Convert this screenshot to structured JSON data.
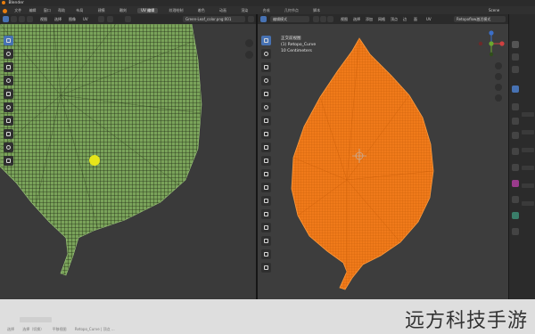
{
  "window": {
    "title": "Blender"
  },
  "menu": {
    "items": [
      "文件",
      "编辑",
      "窗口",
      "帮助"
    ],
    "workspaces": [
      "布局",
      "建模",
      "雕刻",
      "UV 编辑",
      "纹理绘制",
      "着色",
      "动画",
      "渲染",
      "合成",
      "几何节点",
      "脚本"
    ],
    "active_workspace": "UV 编辑"
  },
  "left_header": {
    "mode": "UV 编辑器",
    "image_name": "Green-Leaf_color.png:001",
    "menus": [
      "视图",
      "选择",
      "图像",
      "UV"
    ]
  },
  "right_header": {
    "mode": "编辑模式",
    "menus": [
      "视图",
      "选择",
      "添加",
      "网格",
      "顶点",
      "边",
      "面",
      "UV"
    ],
    "snapping": "Retopoflow激活模式"
  },
  "scene": {
    "name": "Scene"
  },
  "overlay": {
    "line1": "正交前视图",
    "line2": "(1) Retopo_Curve",
    "line3": "10 Centimeters"
  },
  "status_bar": {
    "left": "选择",
    "middle": "平移视图",
    "right": "Retopo_Curve | 顶点 ...",
    "left2": "选择（切换）"
  },
  "watermark": "远方科技手游",
  "colors": {
    "uv_leaf": "#7aa35a",
    "uv_grid": "#1f2a14",
    "mesh_leaf": "#f07a1a",
    "mesh_wire": "#c95d08",
    "cursor_highlight": "#e6e61a",
    "accent": "#4772b3"
  }
}
